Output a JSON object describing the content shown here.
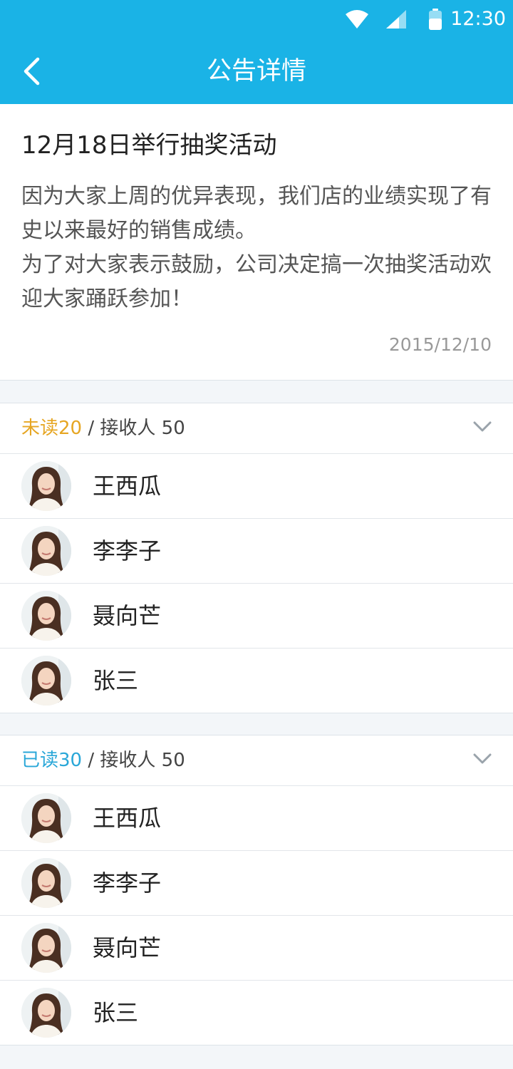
{
  "status_bar": {
    "time": "12:30"
  },
  "nav": {
    "title": "公告详情"
  },
  "notice": {
    "title": "12月18日举行抽奖活动",
    "paragraphs": [
      "因为大家上周的优异表现，我们店的业绩实现了有史以来最好的销售成绩。",
      "为了对大家表示鼓励，公司决定搞一次抽奖活动欢迎大家踊跃参加！"
    ],
    "date": "2015/12/10"
  },
  "unread_section": {
    "status_label": "未读",
    "status_count": "20",
    "recipients_label": " / 接收人 50",
    "members": [
      "王西瓜",
      "李李子",
      "聂向芒",
      "张三"
    ]
  },
  "read_section": {
    "status_label": "已读",
    "status_count": "30",
    "recipients_label": " / 接收人 50",
    "members": [
      "王西瓜",
      "李李子",
      "聂向芒",
      "张三"
    ]
  },
  "colors": {
    "header": "#1ab3e6",
    "unread_accent": "#e6a623",
    "read_accent": "#2aa7d8"
  }
}
